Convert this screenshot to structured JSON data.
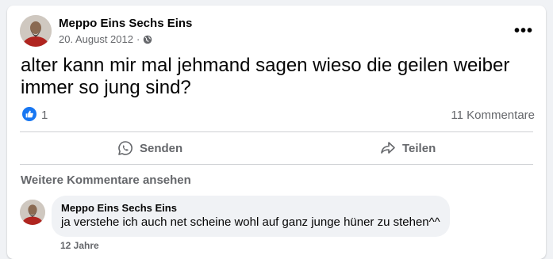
{
  "post": {
    "author": "Meppo Eins Sechs Eins",
    "date": "20. August 2012",
    "separator": "·",
    "visibility_icon": "globe-icon",
    "menu_icon": "more-options-icon",
    "more_label": "•••",
    "text": "alter kann mir mal jehmand sagen wieso die geilen weiber immer so jung sind?",
    "reaction_icon": "like-reaction-icon",
    "reaction_count": "1",
    "comment_count": "11 Kommentare"
  },
  "actions": {
    "send_label": "Senden",
    "send_icon": "whatsapp-icon",
    "share_label": "Teilen",
    "share_icon": "share-arrow-icon"
  },
  "comments": {
    "more_label": "Weitere Kommentare ansehen",
    "items": [
      {
        "author": "Meppo Eins Sechs Eins",
        "text": "ja verstehe ich auch net scheine wohl auf ganz junge hüner zu stehen^^",
        "time": "12 Jahre"
      }
    ]
  },
  "colors": {
    "accent": "#1877f2",
    "secondary_text": "#65676b",
    "background": "#f0f2f5"
  }
}
